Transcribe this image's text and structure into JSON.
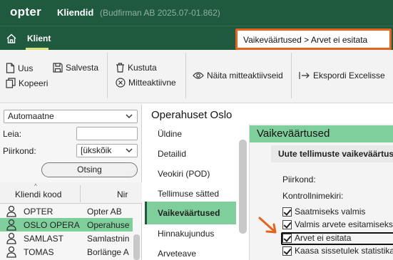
{
  "header": {
    "logo": "opter",
    "app_title": "Kliendid",
    "firm": "(Budfirman AB 2025.07-01.862)"
  },
  "nav": {
    "tab_label": "Klient",
    "search_value": "Vaikeväärtused > Arvet ei esitata"
  },
  "toolbar": {
    "new": "Uus",
    "save": "Salvesta",
    "copy": "Kopeeri",
    "delete": "Kustuta",
    "inactive": "Mitteaktiivne",
    "show_inactive": "Näita mitteaktiivseid",
    "export": "Ekspordi Excelisse"
  },
  "left": {
    "mode_select": "Automaatne",
    "find_label": "Leia:",
    "district_label": "Piirkond:",
    "district_select": "[ükskõik",
    "search_button": "Otsing",
    "col_code": "Kliendi kood",
    "col_name": "Nir",
    "rows": [
      {
        "code": "OPTER",
        "name": "Opter AB"
      },
      {
        "code": "OSLO OPERA",
        "name": "Operahuset"
      },
      {
        "code": "SAMLAST",
        "name": "Samlastnin"
      },
      {
        "code": "TOMAS",
        "name": "Borlänge A"
      }
    ]
  },
  "middle": {
    "title": "Operahuset Oslo",
    "items": [
      "Üldine",
      "Detailid",
      "Veokiri (POD)",
      "Tellimuse sätted",
      "Vaikeväärtused",
      "Hinnakujundus",
      "Arveteave"
    ]
  },
  "right": {
    "title": "Vaikeväärtused",
    "subtitle": "Uute tellimuste vaikeväärtuse",
    "district_label": "Piirkond:",
    "check_label": "Kontrollnimekiri:",
    "checks": [
      "Saatmiseks valmis",
      "Valmis arvete esitamiseks",
      "Arvet ei esitata",
      "Kaasa sissetulek statistika"
    ]
  },
  "colors": {
    "brand_dark": "#1f5a3f",
    "accent_green": "#7ecf9c",
    "highlight_orange": "#e5631d"
  }
}
